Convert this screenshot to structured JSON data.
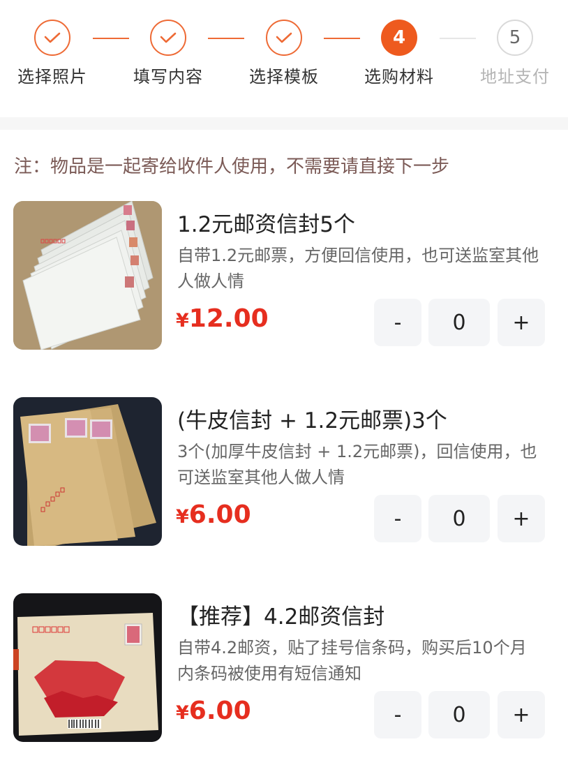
{
  "accent_color": "#ee5a1e",
  "price_color": "#e62e1f",
  "steps": [
    {
      "number": "1",
      "label": "选择照片",
      "state": "done"
    },
    {
      "number": "2",
      "label": "填写内容",
      "state": "done"
    },
    {
      "number": "3",
      "label": "选择模板",
      "state": "done"
    },
    {
      "number": "4",
      "label": "选购材料",
      "state": "active"
    },
    {
      "number": "5",
      "label": "地址支付",
      "state": "pending"
    }
  ],
  "note": "注：物品是一起寄给收件人使用，不需要请直接下一步",
  "products": [
    {
      "title": "1.2元邮资信封5个",
      "desc": "自带1.2元邮票，方便回信使用，也可送监室其他人做人情",
      "currency": "¥",
      "price": "12.00",
      "qty_minus": "-",
      "qty": "0",
      "qty_plus": "+",
      "image": "white-envelopes-photo"
    },
    {
      "title": "(牛皮信封 + 1.2元邮票)3个",
      "desc": "3个(加厚牛皮信封 + 1.2元邮票)，回信使用，也可送监室其他人做人情",
      "currency": "¥",
      "price": "6.00",
      "qty_minus": "-",
      "qty": "0",
      "qty_plus": "+",
      "image": "kraft-envelopes-photo"
    },
    {
      "title": "【推荐】4.2邮资信封",
      "desc": "自带4.2邮资，贴了挂号信条码，购买后10个月内条码被使用有短信通知",
      "currency": "¥",
      "price": "6.00",
      "qty_minus": "-",
      "qty": "0",
      "qty_plus": "+",
      "image": "registered-envelope-photo"
    }
  ]
}
